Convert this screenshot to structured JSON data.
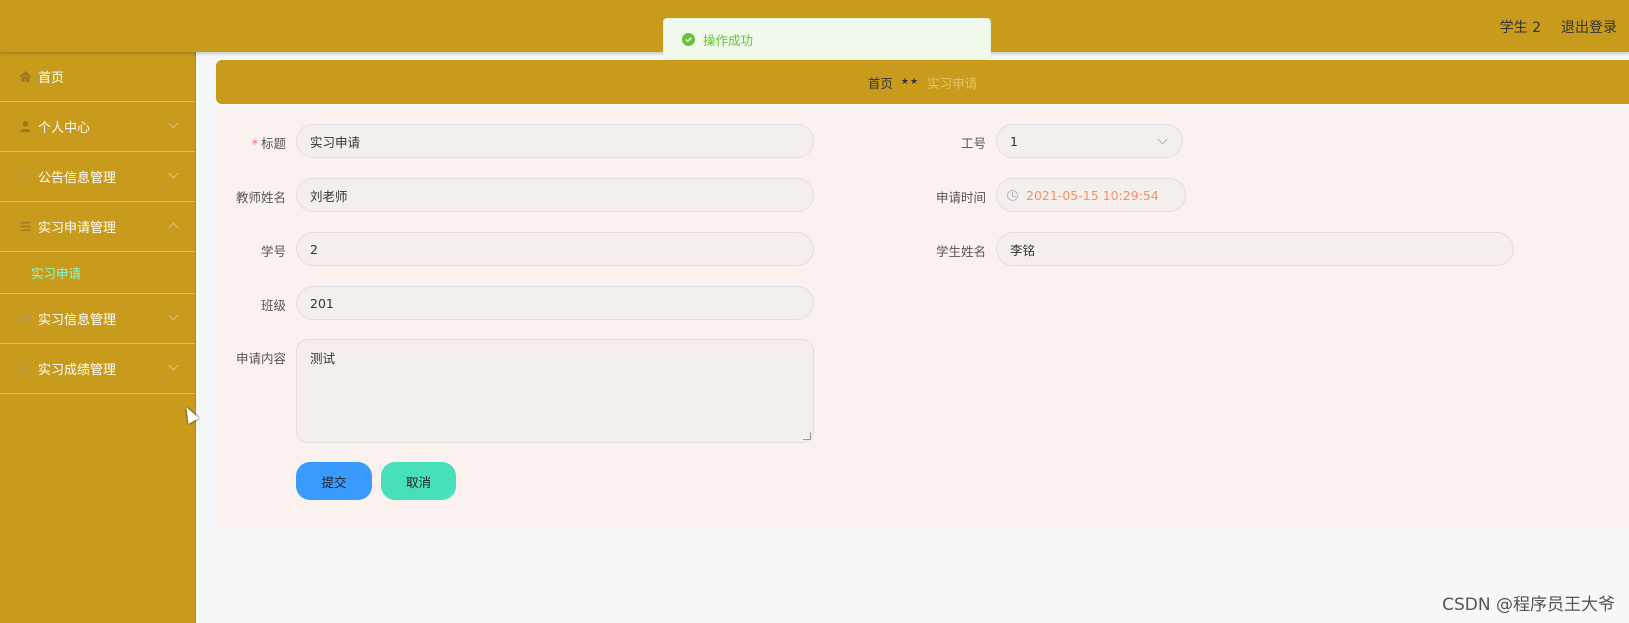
{
  "header": {
    "user_label": "学生 2",
    "logout_label": "退出登录",
    "bg_color": "#c89b1c"
  },
  "toast": {
    "icon": "check-circle-icon",
    "message": "操作成功"
  },
  "sidebar": {
    "items": [
      {
        "label": "首页",
        "icon": "home-icon"
      },
      {
        "label": "个人中心",
        "icon": "user-icon"
      },
      {
        "label": "公告信息管理",
        "icon": "clock-icon"
      },
      {
        "label": "实习申请管理",
        "icon": "list-icon"
      },
      {
        "label": "实习信息管理",
        "icon": "mail-icon"
      },
      {
        "label": "实习成绩管理",
        "icon": "scissors-icon"
      }
    ],
    "open_submenu": {
      "label": "实习申请"
    }
  },
  "breadcrumb": {
    "home": "首页",
    "separator": "★★",
    "current": "实习申请"
  },
  "form": {
    "title": {
      "label": "标题",
      "value": "实习申请",
      "required_mark": "*"
    },
    "job_no": {
      "label": "工号",
      "value": "1"
    },
    "teacher_name": {
      "label": "教师姓名",
      "value": "刘老师"
    },
    "apply_time": {
      "label": "申请时间",
      "value": "2021-05-15 10:29:54"
    },
    "student_no": {
      "label": "学号",
      "value": "2"
    },
    "student_name": {
      "label": "学生姓名",
      "value": "李铭"
    },
    "class": {
      "label": "班级",
      "value": "201"
    },
    "content": {
      "label": "申请内容",
      "value": "测试"
    },
    "submit_label": "提交",
    "cancel_label": "取消"
  },
  "watermark": "CSDN @程序员王大爷"
}
